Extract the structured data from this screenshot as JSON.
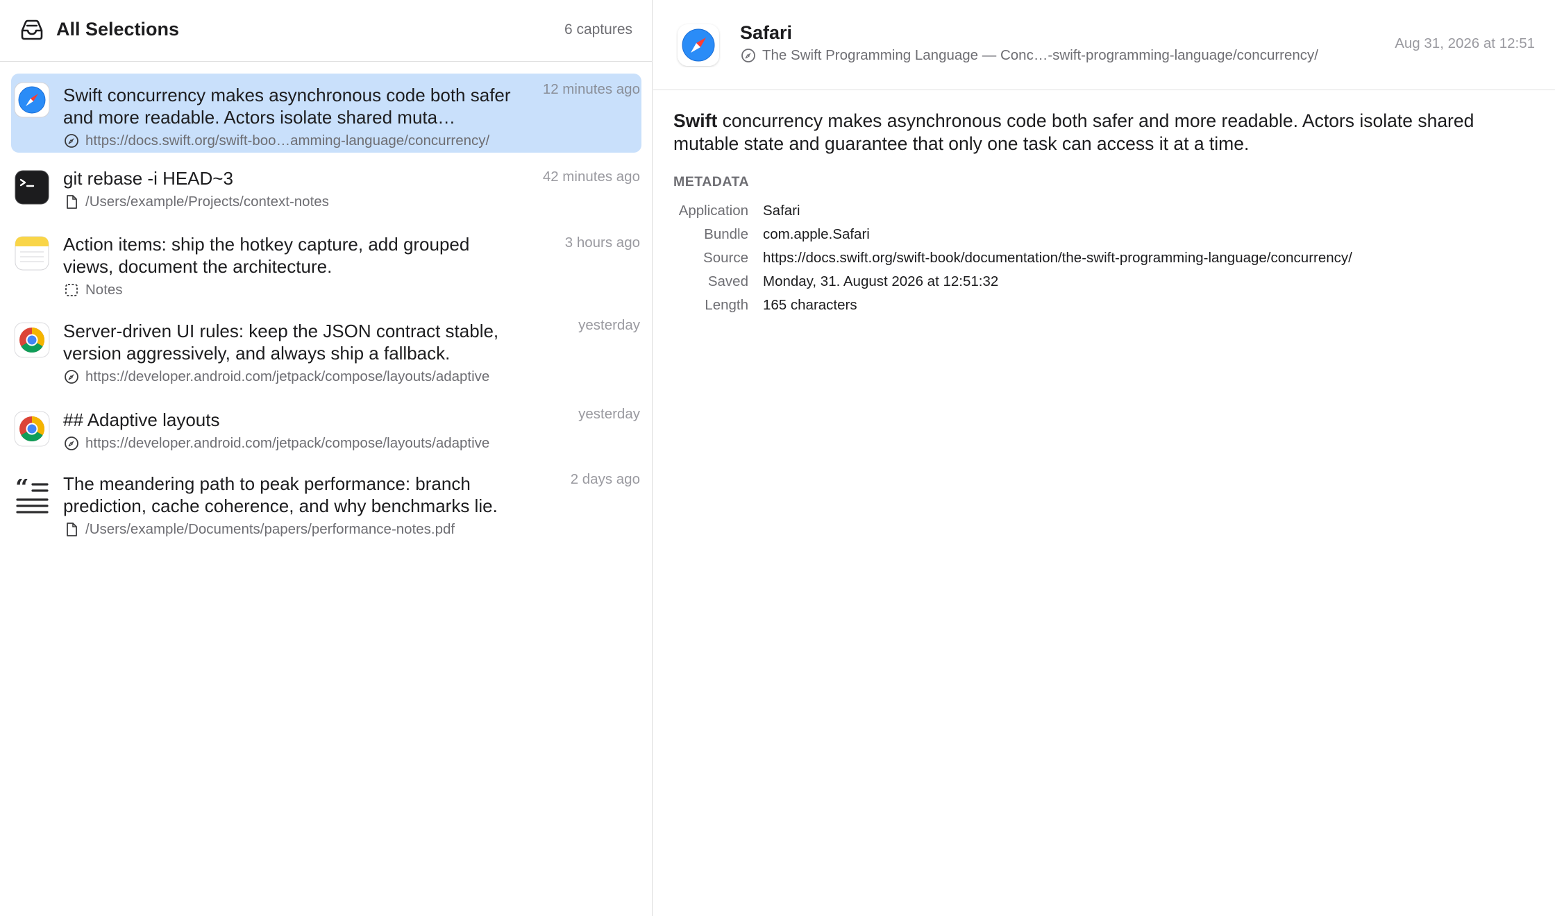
{
  "sidebar": {
    "title": "All Selections",
    "count": "6 captures"
  },
  "captures": [
    {
      "app": "Safari",
      "icon": "safari-icon",
      "title": "Swift concurrency makes asynchronous code both safer and more readable. Actors isolate shared muta…",
      "source_icon": "compass-icon",
      "source": "https://docs.swift.org/swift-boo…amming-language/concurrency/",
      "time": "12 minutes ago",
      "selected": true
    },
    {
      "app": "Terminal",
      "icon": "terminal-icon",
      "title": "git rebase -i HEAD~3",
      "source_icon": "document-icon",
      "source": "/Users/example/Projects/context-notes",
      "time": "42 minutes ago"
    },
    {
      "app": "Notes",
      "icon": "notes-icon",
      "title": "Action items: ship the hotkey capture, add grouped views, document the architecture.",
      "source_icon": "dashed-square-icon",
      "source": "Notes",
      "time": "3 hours ago"
    },
    {
      "app": "Chrome",
      "icon": "chrome-icon",
      "title": "Server-driven UI rules: keep the JSON contract stable, version aggressively, and always ship a fallback.",
      "source_icon": "compass-icon",
      "source": "https://developer.android.com/jetpack/compose/layouts/adaptive",
      "time": "yesterday"
    },
    {
      "app": "Chrome",
      "icon": "chrome-icon",
      "title": "## Adaptive layouts",
      "source_icon": "compass-icon",
      "source": "https://developer.android.com/jetpack/compose/layouts/adaptive",
      "time": "yesterday"
    },
    {
      "app": "Quote",
      "icon": "quote-icon",
      "title": "The meandering path to peak performance: branch prediction, cache coherence, and why benchmarks lie.",
      "source_icon": "document-icon",
      "source": "/Users/example/Documents/papers/performance-notes.pdf",
      "time": "2 days ago"
    }
  ],
  "detail": {
    "app_name": "Safari",
    "source_title": "The Swift Programming Language — Conc…-swift-programming-language/concurrency/",
    "timestamp": "Aug 31, 2026 at 12:51",
    "content_bold": "Swift",
    "content_rest": " concurrency makes asynchronous code both safer and more readable. Actors isolate shared mutable state and guarantee that only one task can access it at a time.",
    "metadata_heading": "METADATA",
    "metadata": [
      {
        "key": "Application",
        "value": "Safari"
      },
      {
        "key": "Bundle",
        "value": "com.apple.Safari"
      },
      {
        "key": "Source",
        "value": "https://docs.swift.org/swift-book/documentation/the-swift-programming-language/concurrency/"
      },
      {
        "key": "Saved",
        "value": "Monday, 31. August 2026 at 12:51:32"
      },
      {
        "key": "Length",
        "value": "165 characters"
      }
    ]
  },
  "colors": {
    "selection": "#c9e0fb",
    "safari_blue": "#1e88f5",
    "secondary_text": "#6e6e73",
    "tertiary_text": "#9a9aa0"
  }
}
